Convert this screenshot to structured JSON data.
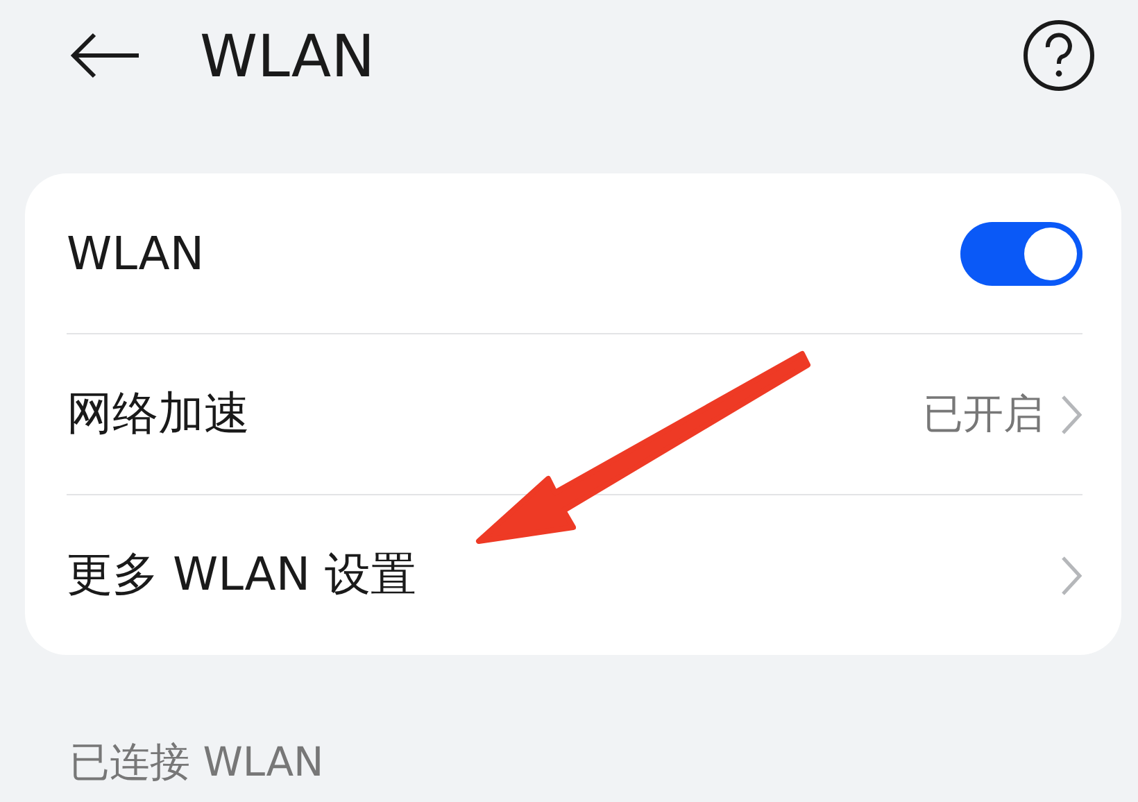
{
  "header": {
    "title": "WLAN"
  },
  "settings": [
    {
      "kind": "switch",
      "label": "WLAN",
      "on": true
    },
    {
      "kind": "link",
      "label": "网络加速",
      "value": "已开启"
    },
    {
      "kind": "link",
      "label": "更多 WLAN 设置"
    }
  ],
  "section_header": "已连接 WLAN"
}
